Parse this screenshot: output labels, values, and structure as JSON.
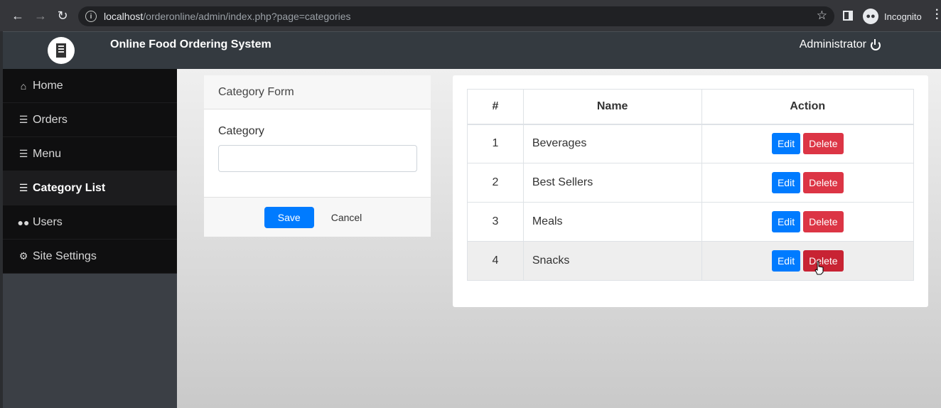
{
  "browser": {
    "url_host": "localhost",
    "url_path": "/orderonline/admin/index.php?page=categories",
    "profile_label": "Incognito"
  },
  "header": {
    "title": "Online Food Ordering System",
    "user": "Administrator"
  },
  "sidebar": {
    "items": [
      {
        "label": "Home",
        "icon": "home-icon"
      },
      {
        "label": "Orders",
        "icon": "list-icon"
      },
      {
        "label": "Menu",
        "icon": "list-icon"
      },
      {
        "label": "Category List",
        "icon": "list-icon",
        "active": true
      },
      {
        "label": "Users",
        "icon": "users-icon"
      },
      {
        "label": "Site Settings",
        "icon": "cogs-icon"
      }
    ]
  },
  "form": {
    "title": "Category Form",
    "field_label": "Category",
    "field_value": "",
    "save_label": "Save",
    "cancel_label": "Cancel"
  },
  "table": {
    "headers": [
      "#",
      "Name",
      "Action"
    ],
    "rows": [
      {
        "num": "1",
        "name": "Beverages"
      },
      {
        "num": "2",
        "name": "Best Sellers"
      },
      {
        "num": "3",
        "name": "Meals"
      },
      {
        "num": "4",
        "name": "Snacks"
      }
    ],
    "edit_label": "Edit",
    "delete_label": "Delete"
  },
  "colors": {
    "primary": "#007bff",
    "danger": "#dc3545",
    "header_bg": "#343a40"
  }
}
